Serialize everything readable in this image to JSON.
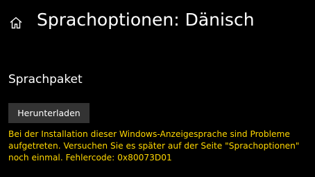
{
  "header": {
    "home_icon": "home-icon",
    "title": "Sprachoptionen: Dänisch"
  },
  "language_pack": {
    "section_title": "Sprachpaket",
    "download_label": "Herunterladen",
    "error_message": "Bei der Installation dieser Windows-Anzeigesprache sind Probleme aufgetreten. Versuchen Sie es später auf der Seite \"Sprachoptionen\" noch einmal. Fehlercode: 0x80073D01"
  },
  "colors": {
    "background": "#000000",
    "text": "#ffffff",
    "button_background": "#333333",
    "error_text": "#ffd700"
  }
}
